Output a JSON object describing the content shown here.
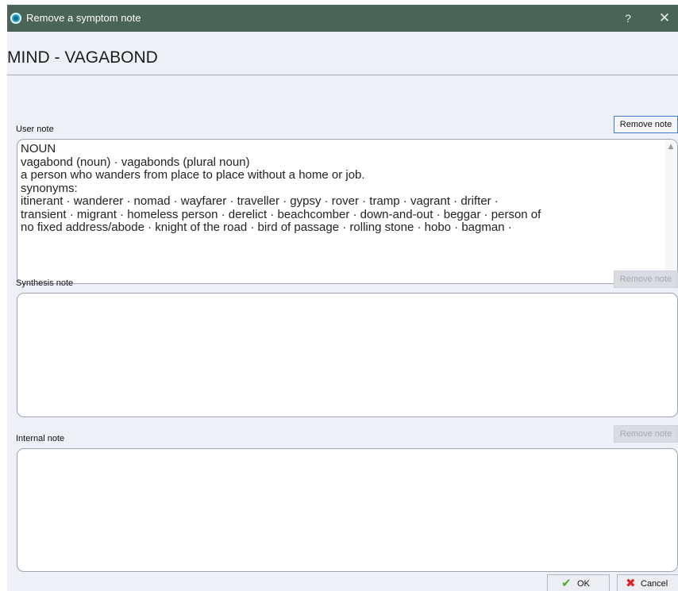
{
  "window": {
    "title": "Remove a symptom note",
    "help_label": "?",
    "close_label": "✕"
  },
  "symptom": {
    "title": "MIND - VAGABOND"
  },
  "sections": {
    "user_note": {
      "label": "User note",
      "remove_label": "Remove note",
      "remove_enabled": true,
      "lines": [
        "NOUN",
        "vagabond (noun) · vagabonds (plural noun)",
        "a person who wanders from place to place without a home or job.",
        "synonyms:",
        "itinerant · wanderer · nomad · wayfarer · traveller · gypsy · rover · tramp · vagrant · drifter ·",
        "transient · migrant · homeless person · derelict · beachcomber · down-and-out · beggar · person of",
        "no fixed address/abode · knight of the road · bird of passage · rolling stone · hobo · bagman ·"
      ]
    },
    "synthesis_note": {
      "label": "Synthesis note",
      "remove_label": "Remove note",
      "remove_enabled": false,
      "value": ""
    },
    "internal_note": {
      "label": "Internal note",
      "remove_label": "Remove note",
      "remove_enabled": false,
      "value": ""
    }
  },
  "buttons": {
    "ok_label": "OK",
    "cancel_label": "Cancel"
  },
  "icons": {
    "app": "app-logo-icon",
    "ok": "checkmark-icon",
    "cancel": "x-icon",
    "scroll_up": "chevron-up-icon",
    "scroll_down": "chevron-down-icon"
  },
  "colors": {
    "titlebar": "#4a6457",
    "dialog_background": "#eef0f8",
    "ok_check": "#4caf2a",
    "cancel_x": "#e02424",
    "focus_border": "#3c7fd0"
  }
}
